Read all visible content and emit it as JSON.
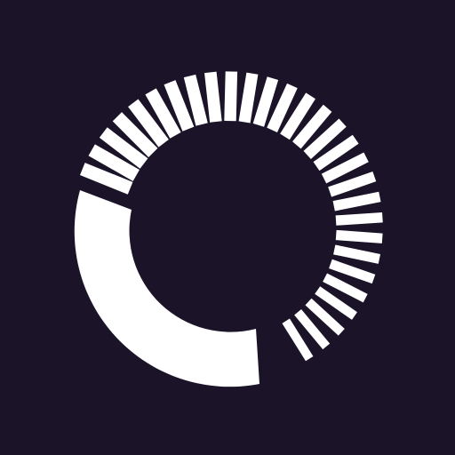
{
  "icon": {
    "name": "radial-ring-logo-icon",
    "background_color": "#1b1429",
    "foreground_color": "#ffffff"
  }
}
